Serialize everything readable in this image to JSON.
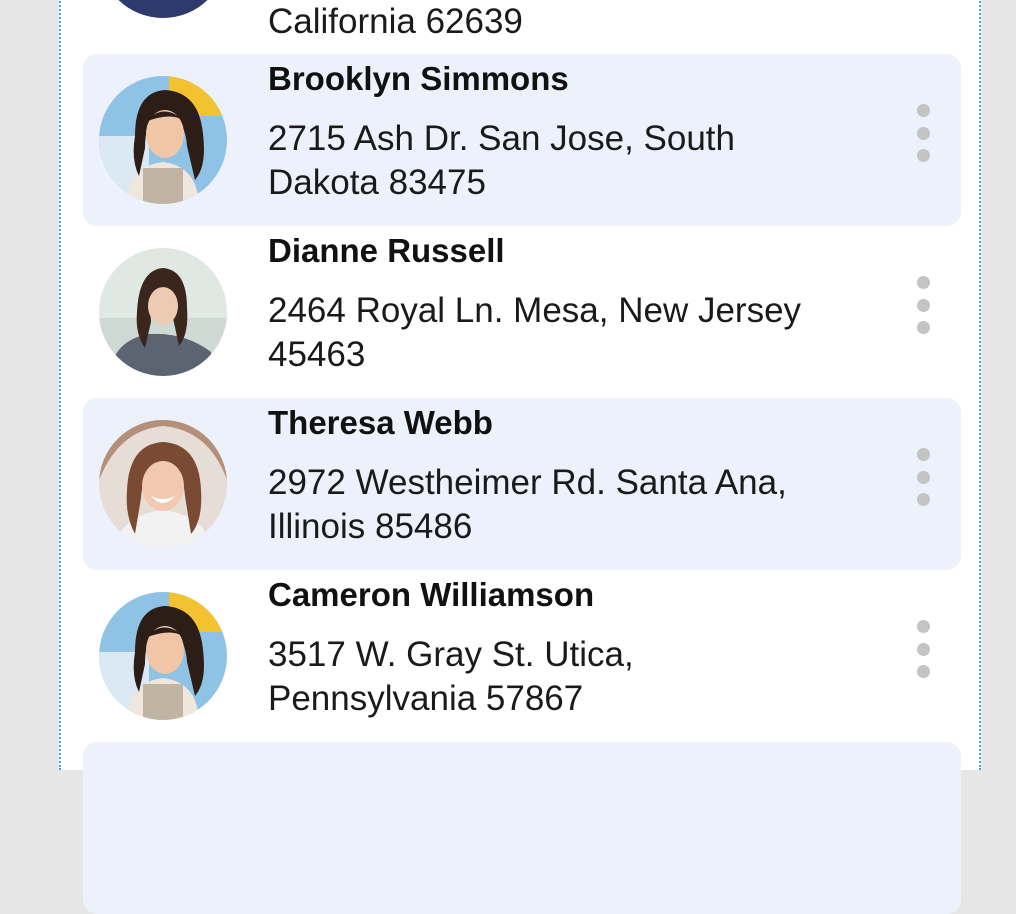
{
  "contacts": [
    {
      "name": "",
      "address": "California 62639"
    },
    {
      "name": "Brooklyn Simmons",
      "address": "2715 Ash Dr. San Jose, South Dakota 83475"
    },
    {
      "name": "Dianne Russell",
      "address": "2464 Royal Ln. Mesa, New Jersey 45463"
    },
    {
      "name": "Theresa Webb",
      "address": "2972 Westheimer Rd. Santa Ana, Illinois 85486"
    },
    {
      "name": "Cameron Williamson",
      "address": "3517 W. Gray St. Utica, Pennsylvania 57867"
    }
  ],
  "icons": {
    "menu": "more-vertical-icon",
    "avatar": "avatar-photo"
  },
  "colors": {
    "highlight_row": "#edf1fb",
    "menu_dots": "#c4c4c4",
    "frame_border": "#4aa3df"
  }
}
